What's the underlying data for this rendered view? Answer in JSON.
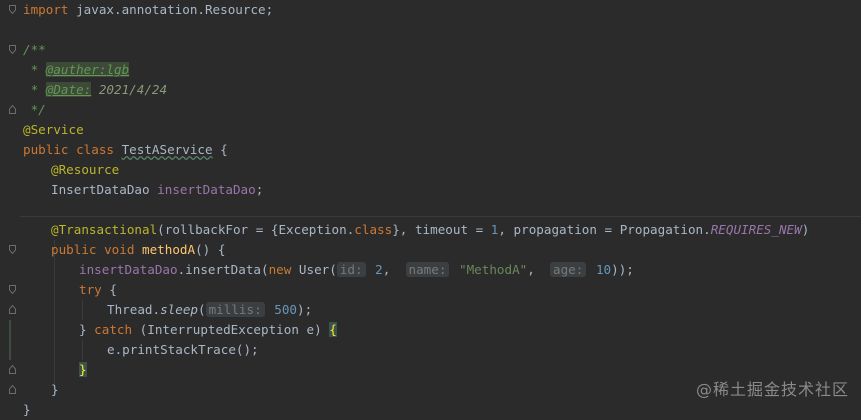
{
  "code": {
    "l1": {
      "import": "import",
      "rest": " javax.annotation.Resource;"
    },
    "l2": {
      "text": "/**"
    },
    "l3": {
      "star": " * ",
      "tag": "@auther:",
      "val": "lgb"
    },
    "l4": {
      "star": " * ",
      "tag": "@Date:",
      "val": " 2021/4/24"
    },
    "l5": {
      "text": " */"
    },
    "l6": {
      "ann": "@Service"
    },
    "l7": {
      "kw": "public class ",
      "name": "TestAService",
      "rest": " {"
    },
    "l8": {
      "ann": "@Resource"
    },
    "l9": {
      "type": "InsertDataDao ",
      "field": "insertDataDao",
      "rest": ";"
    },
    "l10": {
      "ann": "@Transactional",
      "p1": "(rollbackFor = {Exception.",
      "kw1": "class",
      "p2": "}, timeout = ",
      "num": "1",
      "p3": ", propagation = Propagation.",
      "const": "REQUIRES_NEW",
      "p4": ")"
    },
    "l11": {
      "kw": "public void ",
      "method": "methodA",
      "rest": "() {"
    },
    "l12": {
      "field": "insertDataDao",
      "p1": ".insertData(",
      "kw": "new ",
      "p2": "User(",
      "hint1": "id:",
      "v1": " 2",
      "c1": ",  ",
      "hint2": "name:",
      "v2": " \"MethodA\"",
      "c2": ",  ",
      "hint3": "age:",
      "v3": " 10",
      "p3": "));"
    },
    "l13": {
      "kw": "try",
      "rest": " {"
    },
    "l14": {
      "p1": "Thread.",
      "method": "sleep",
      "p2": "(",
      "hint": "millis:",
      "num": " 500",
      "p3": ");"
    },
    "l15": {
      "p1": "} ",
      "kw": "catch",
      "p2": " (InterruptedException e) ",
      "brace": "{"
    },
    "l16": {
      "text": "e.printStackTrace();"
    },
    "l17": {
      "brace": "}"
    },
    "l18": {
      "text": "}"
    },
    "l19": {
      "text": "}"
    }
  },
  "watermark": "@稀土掘金技术社区",
  "colors": {
    "background": "#2b2b2b",
    "keyword": "#cc7832",
    "annotation": "#bbb529",
    "comment": "#629755",
    "field": "#9876aa",
    "number": "#6897bb",
    "string": "#6a8759",
    "method": "#ffc66d"
  }
}
